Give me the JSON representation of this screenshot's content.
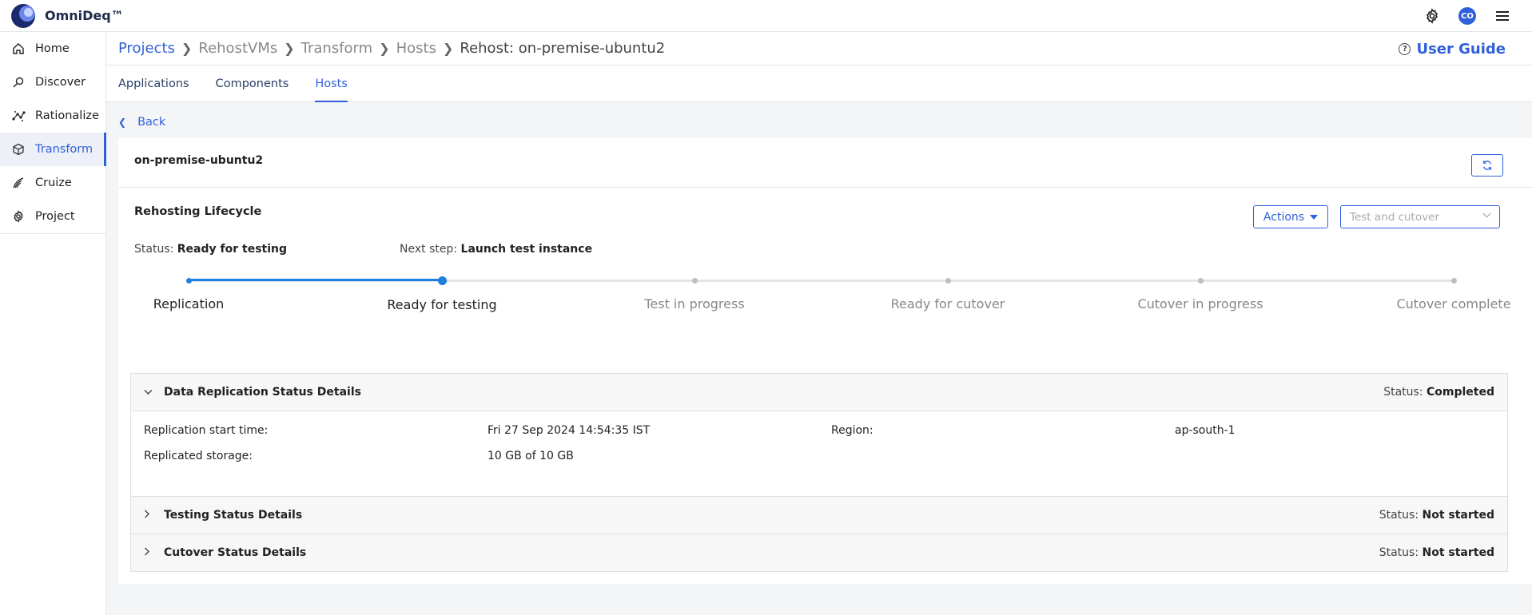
{
  "app": {
    "name": "OmniDeq™"
  },
  "topbar": {
    "avatar_initials": "CO"
  },
  "sidebar": {
    "items": [
      {
        "label": "Home",
        "icon": "home-icon"
      },
      {
        "label": "Discover",
        "icon": "discover-icon"
      },
      {
        "label": "Rationalize",
        "icon": "rationalize-icon"
      },
      {
        "label": "Transform",
        "icon": "cube-icon",
        "active": true
      },
      {
        "label": "Cruize",
        "icon": "cruize-icon"
      },
      {
        "label": "Project",
        "icon": "gear-icon"
      }
    ]
  },
  "breadcrumb": [
    "Projects",
    "RehostVMs",
    "Transform",
    "Hosts",
    "Rehost: on-premise-ubuntu2"
  ],
  "header": {
    "user_guide": "User Guide"
  },
  "tabs": [
    "Applications",
    "Components",
    "Hosts"
  ],
  "back_label": "Back",
  "host": {
    "name": "on-premise-ubuntu2"
  },
  "lifecycle": {
    "title": "Rehosting Lifecycle",
    "actions_label": "Actions",
    "select_placeholder": "Test and cutover",
    "status_label": "Status:",
    "status_value": "Ready for testing",
    "next_label": "Next step:",
    "next_value": "Launch test instance",
    "steps": [
      "Replication",
      "Ready for testing",
      "Test in progress",
      "Ready for cutover",
      "Cutover in progress",
      "Cutover complete"
    ],
    "current_step_index": 1
  },
  "sections": {
    "replication": {
      "title": "Data Replication Status Details",
      "status_label": "Status:",
      "status_value": "Completed",
      "start_time_label": "Replication start time:",
      "start_time_value": "Fri 27 Sep 2024 14:54:35 IST",
      "region_label": "Region:",
      "region_value": "ap-south-1",
      "storage_label": "Replicated storage:",
      "storage_value": "10 GB of 10 GB"
    },
    "testing": {
      "title": "Testing Status Details",
      "status_label": "Status:",
      "status_value": "Not started"
    },
    "cutover": {
      "title": "Cutover Status Details",
      "status_label": "Status:",
      "status_value": "Not started"
    }
  },
  "colors": {
    "accent": "#2f5fdb",
    "progress": "#1f7fe0",
    "pending": "#bdbdbd"
  }
}
